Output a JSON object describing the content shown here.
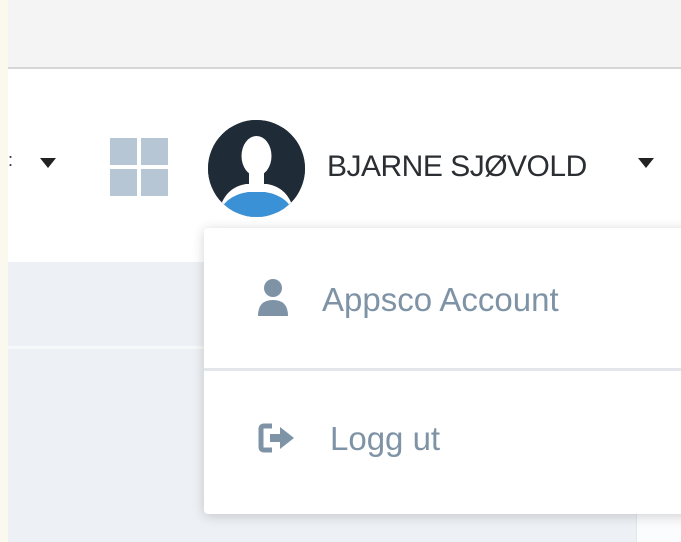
{
  "header": {
    "user": {
      "name": "BJARNE SJØVOLD",
      "avatar_icon": "user-silhouette-icon",
      "menu_icon": "caret-down-icon"
    },
    "apps_icon": "grid-icon",
    "left_menu_icon": "caret-down-icon"
  },
  "user_menu": {
    "items": [
      {
        "label": "Appsco Account",
        "icon": "user-icon"
      },
      {
        "label": "Logg ut",
        "icon": "sign-out-icon"
      }
    ]
  },
  "colors": {
    "menu_text": "#7e93a6",
    "apps_icon": "#b7c6d5",
    "avatar_background": "#1f2b36",
    "avatar_shirt": "#3a91d6"
  }
}
